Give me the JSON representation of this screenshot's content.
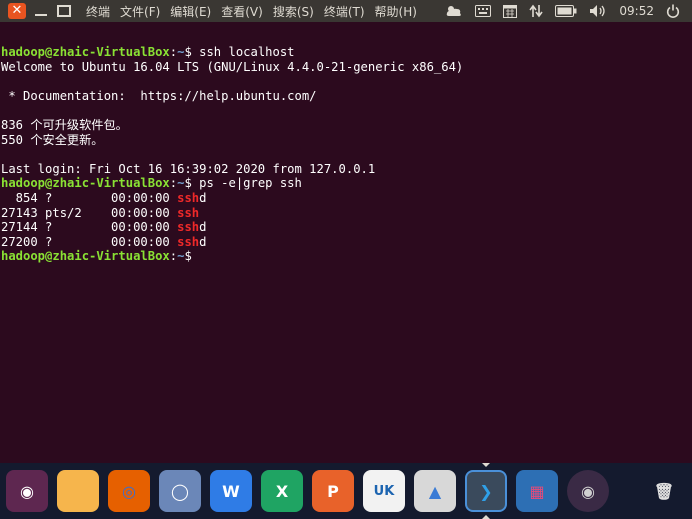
{
  "topbar": {
    "menus": [
      "终端",
      "文件(F)",
      "编辑(E)",
      "查看(V)",
      "搜索(S)",
      "终端(T)",
      "帮助(H)"
    ],
    "clock": "09:52",
    "indicator_icons": [
      "weather-cloud-icon",
      "keyboard-icon",
      "calendar-icon",
      "network-transfer-icon",
      "battery-icon",
      "volume-icon",
      "power-icon"
    ]
  },
  "terminal": {
    "lines": [
      [
        {
          "t": "hadoop@zhaic-VirtualBox",
          "c": "prompt"
        },
        {
          "t": ":",
          "c": ""
        },
        {
          "t": "~",
          "c": "path"
        },
        {
          "t": "$ ssh localhost",
          "c": ""
        }
      ],
      [
        {
          "t": "Welcome to Ubuntu 16.04 LTS (GNU/Linux 4.4.0-21-generic x86_64)",
          "c": ""
        }
      ],
      [],
      [
        {
          "t": " * Documentation:  https://help.ubuntu.com/",
          "c": ""
        }
      ],
      [],
      [
        {
          "t": "836 个可升级软件包。",
          "c": ""
        }
      ],
      [
        {
          "t": "550 个安全更新。",
          "c": ""
        }
      ],
      [],
      [
        {
          "t": "Last login: Fri Oct 16 16:39:02 2020 from 127.0.0.1",
          "c": ""
        }
      ],
      [
        {
          "t": "hadoop@zhaic-VirtualBox",
          "c": "prompt"
        },
        {
          "t": ":",
          "c": ""
        },
        {
          "t": "~",
          "c": "path"
        },
        {
          "t": "$ ps -e|grep ssh",
          "c": ""
        }
      ],
      [
        {
          "t": "  854 ?        00:00:00 ",
          "c": ""
        },
        {
          "t": "ssh",
          "c": "hl"
        },
        {
          "t": "d",
          "c": ""
        }
      ],
      [
        {
          "t": "27143 pts/2    00:00:00 ",
          "c": ""
        },
        {
          "t": "ssh",
          "c": "hl"
        }
      ],
      [
        {
          "t": "27144 ?        00:00:00 ",
          "c": ""
        },
        {
          "t": "ssh",
          "c": "hl"
        },
        {
          "t": "d",
          "c": ""
        }
      ],
      [
        {
          "t": "27200 ?        00:00:00 ",
          "c": ""
        },
        {
          "t": "ssh",
          "c": "hl"
        },
        {
          "t": "d",
          "c": ""
        }
      ],
      [
        {
          "t": "hadoop@zhaic-VirtualBox",
          "c": "prompt"
        },
        {
          "t": ":",
          "c": ""
        },
        {
          "t": "~",
          "c": "path"
        },
        {
          "t": "$",
          "c": ""
        }
      ]
    ]
  },
  "dock": {
    "items": [
      {
        "name": "ubuntu-launcher-icon",
        "bg": "#5e2750",
        "glyph": "◉",
        "fg": "#ffffff"
      },
      {
        "name": "files-folder-icon",
        "bg": "#f6b54c",
        "glyph": "",
        "fg": "#ffffff"
      },
      {
        "name": "firefox-icon",
        "bg": "#e66000",
        "glyph": "◎",
        "fg": "#3a6fcf"
      },
      {
        "name": "chromium-icon",
        "bg": "#6b87b8",
        "glyph": "◯",
        "fg": "#ffffff"
      },
      {
        "name": "wps-writer-icon",
        "bg": "#2f7ce6",
        "glyph": "W",
        "fg": "#ffffff"
      },
      {
        "name": "wps-spreadsheet-icon",
        "bg": "#1fa463",
        "glyph": "X",
        "fg": "#ffffff"
      },
      {
        "name": "wps-presentation-icon",
        "bg": "#e8622a",
        "glyph": "P",
        "fg": "#ffffff"
      },
      {
        "name": "amazon-store-icon",
        "bg": "#f2f2f2",
        "glyph": "UK",
        "fg": "#1c64b0"
      },
      {
        "name": "software-updater-icon",
        "bg": "#d8d8d8",
        "glyph": "▲",
        "fg": "#3a7bd5"
      },
      {
        "name": "terminal-icon",
        "bg": "#3a4a5c",
        "glyph": "❯",
        "fg": "#2fa0e8"
      },
      {
        "name": "workspace-switcher-icon",
        "bg": "#2d6fb4",
        "glyph": "▦",
        "fg": "#e44b7a"
      },
      {
        "name": "dvd-drive-icon",
        "bg": "#3a2a45",
        "glyph": "◉",
        "fg": "#d0d0d0"
      },
      {
        "name": "trash-icon",
        "bg": "#141a2e",
        "glyph": "🗑",
        "fg": "#e0e0e0"
      }
    ],
    "running_app": "terminal-icon"
  }
}
